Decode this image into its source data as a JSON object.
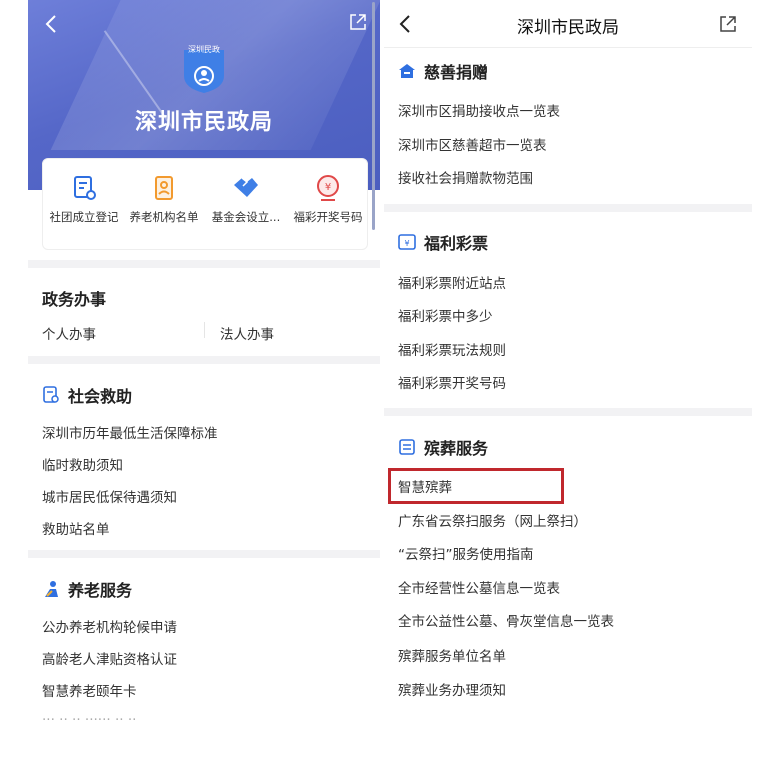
{
  "left": {
    "header_title": "深圳市民政局",
    "emblem_text": "深圳民政",
    "quick_links": [
      "社团成立登记",
      "养老机构名单",
      "基金会设立...",
      "福彩开奖号码"
    ],
    "gov_affairs": {
      "title": "政务办事",
      "personal": "个人办事",
      "legal": "法人办事"
    },
    "social_relief": {
      "title": "社会救助",
      "items": [
        "深圳市历年最低生活保障标准",
        "临时救助须知",
        "城市居民低保待遇须知",
        "救助站名单"
      ]
    },
    "elderly": {
      "title": "养老服务",
      "items": [
        "公办养老机构轮候申请",
        "高龄老人津贴资格认证",
        "智慧养老颐年卡"
      ]
    }
  },
  "right": {
    "header_title": "深圳市民政局",
    "charity": {
      "title": "慈善捐赠",
      "items": [
        "深圳市区捐助接收点一览表",
        "深圳市区慈善超市一览表",
        "接收社会捐赠款物范围"
      ]
    },
    "lottery": {
      "title": "福利彩票",
      "items": [
        "福利彩票附近站点",
        "福利彩票中多少",
        "福利彩票玩法规则",
        "福利彩票开奖号码"
      ]
    },
    "funeral": {
      "title": "殡葬服务",
      "items": [
        "智慧殡葬",
        "广东省云祭扫服务（网上祭扫）",
        "“云祭扫”服务使用指南",
        "全市经营性公墓信息一览表",
        "全市公益性公墓、骨灰堂信息一览表",
        "殡葬服务单位名单",
        "殡葬业务办理须知"
      ]
    }
  },
  "colors": {
    "hero": "#5567c8",
    "accent": "#2f6fe0",
    "highlight": "#c0282d"
  }
}
